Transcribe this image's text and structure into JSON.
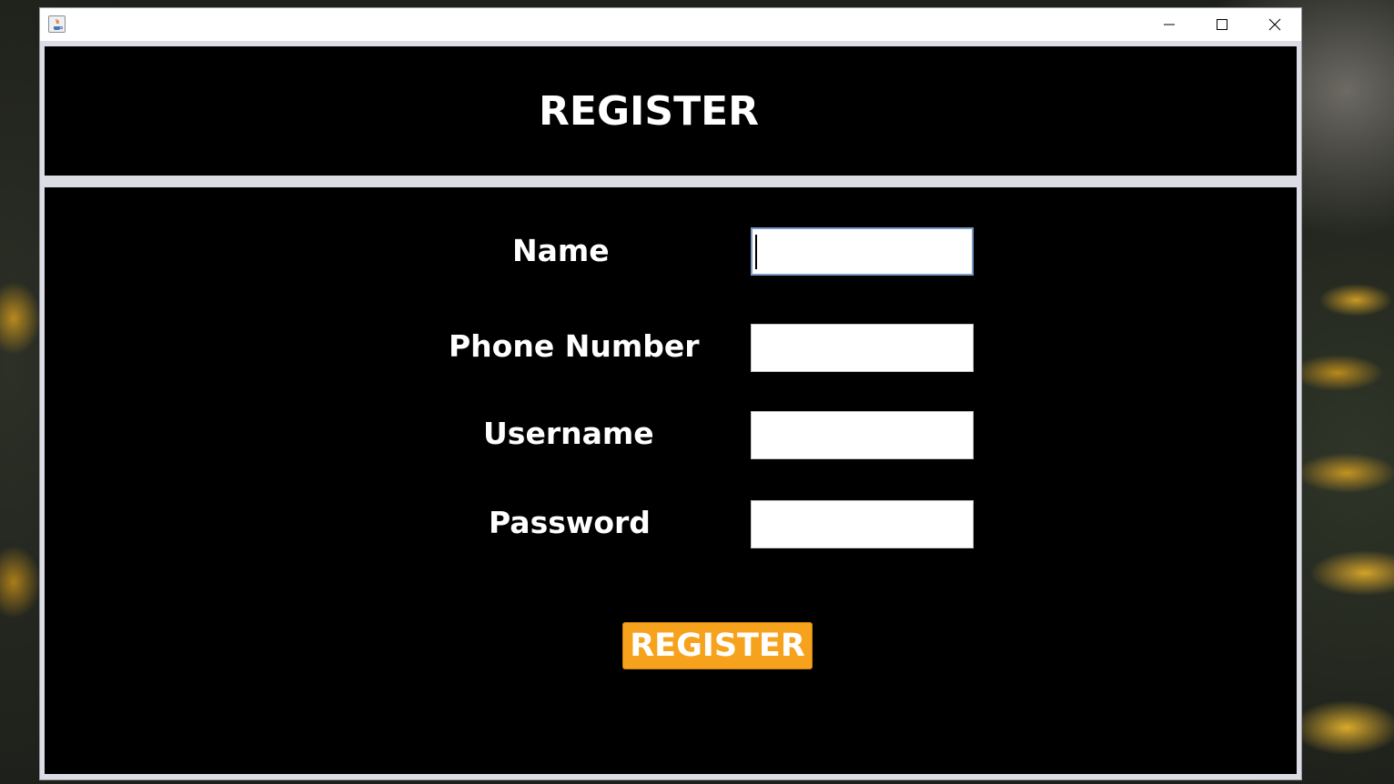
{
  "window": {
    "title": "",
    "controls": {
      "minimize": "minimize-icon",
      "maximize": "maximize-icon",
      "close": "close-icon"
    }
  },
  "header": {
    "title": "REGISTER"
  },
  "form": {
    "fields": [
      {
        "label": "Name",
        "value": "",
        "focused": true
      },
      {
        "label": "Phone Number",
        "value": ""
      },
      {
        "label": "Username",
        "value": ""
      },
      {
        "label": "Password",
        "value": ""
      }
    ],
    "submit_label": "REGISTER"
  },
  "colors": {
    "panel_background": "#000000",
    "text": "#ffffff",
    "button_background": "#f7a21c",
    "window_frame": "#dcdce4"
  }
}
